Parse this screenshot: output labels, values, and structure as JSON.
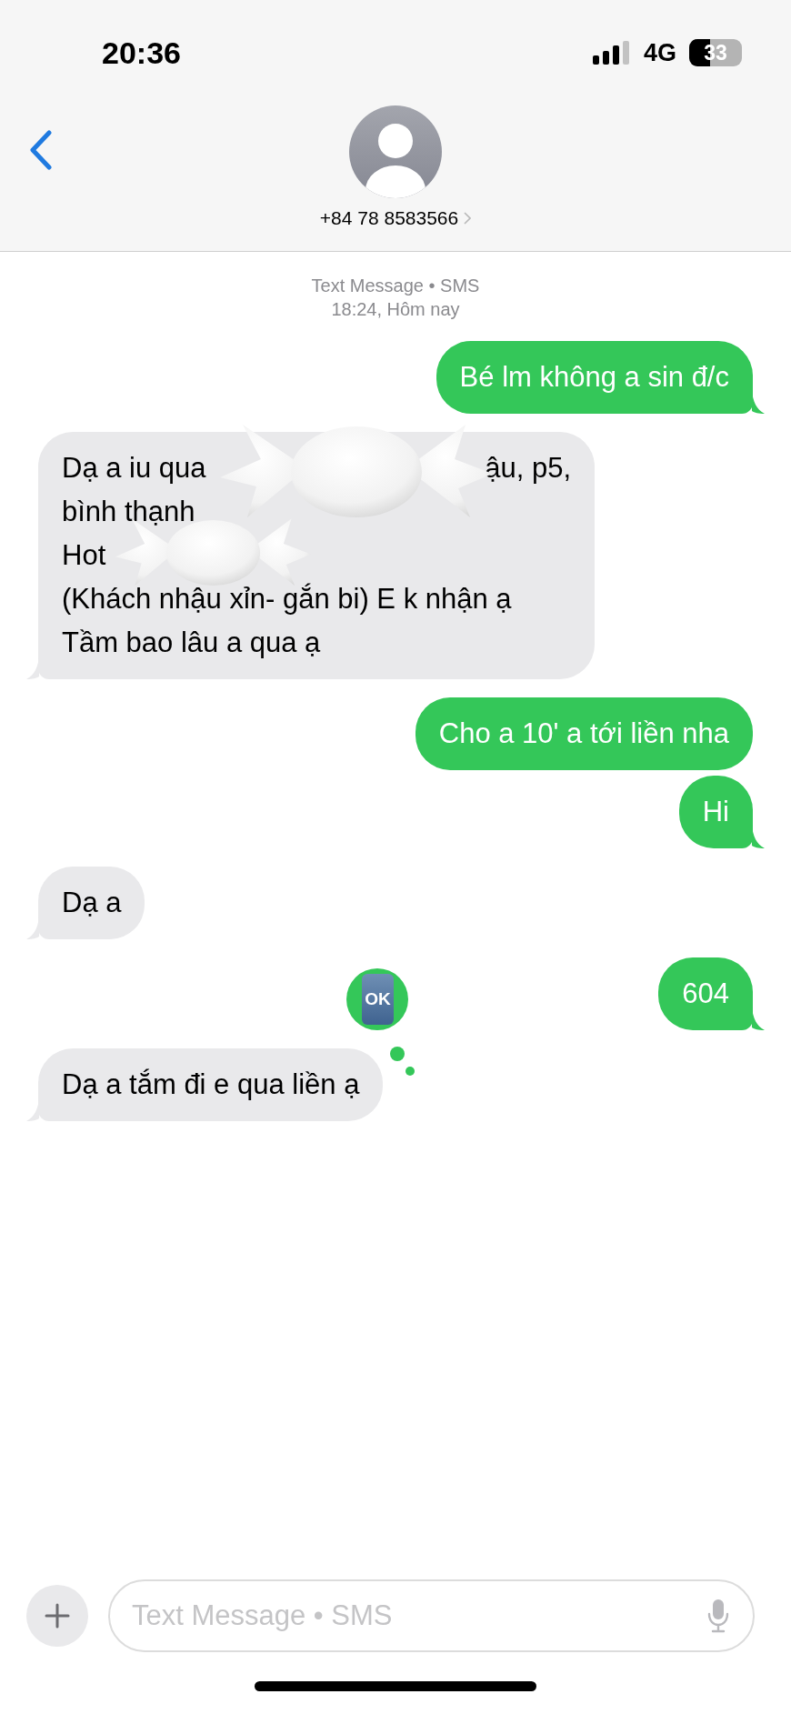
{
  "status_bar": {
    "time": "20:36",
    "network": "4G",
    "battery": "33"
  },
  "contact": {
    "phone": "+84 78 8583566"
  },
  "thread_header": {
    "service": "Text Message • SMS",
    "timestamp": "18:24, Hôm nay"
  },
  "messages": [
    {
      "kind": "sent",
      "lines": [
        {
          "parts": [
            "Bé lm không a sin đ/c"
          ]
        }
      ]
    },
    {
      "kind": "received",
      "lines": [
        {
          "parts": [
            "Dạ a iu qua",
            "ậu, p5,"
          ]
        },
        {
          "parts": [
            "bình thạnh"
          ]
        },
        {
          "parts": [
            "Hot"
          ]
        },
        {
          "parts": [
            "(Khách nhậu xỉn- gắn bi) E k nhận ạ"
          ]
        },
        {
          "parts": [
            "Tầm bao lâu a qua ạ"
          ]
        }
      ],
      "stickers": [
        {
          "kind": "candy"
        },
        {
          "kind": "candy"
        }
      ]
    },
    {
      "kind": "sent",
      "lines": [
        {
          "parts": [
            "Cho a 10' a tới liền nha"
          ]
        }
      ]
    },
    {
      "kind": "sent",
      "lines": [
        {
          "parts": [
            "Hi"
          ]
        }
      ]
    },
    {
      "kind": "received",
      "lines": [
        {
          "parts": [
            "Dạ a"
          ]
        }
      ]
    },
    {
      "kind": "sent",
      "lines": [
        {
          "parts": [
            "604"
          ]
        }
      ]
    },
    {
      "kind": "received",
      "lines": [
        {
          "parts": [
            "Dạ a tắm đi e qua liền ạ"
          ]
        }
      ],
      "tapback": {
        "label": "OK"
      }
    }
  ],
  "composer": {
    "placeholder": "Text Message • SMS"
  }
}
